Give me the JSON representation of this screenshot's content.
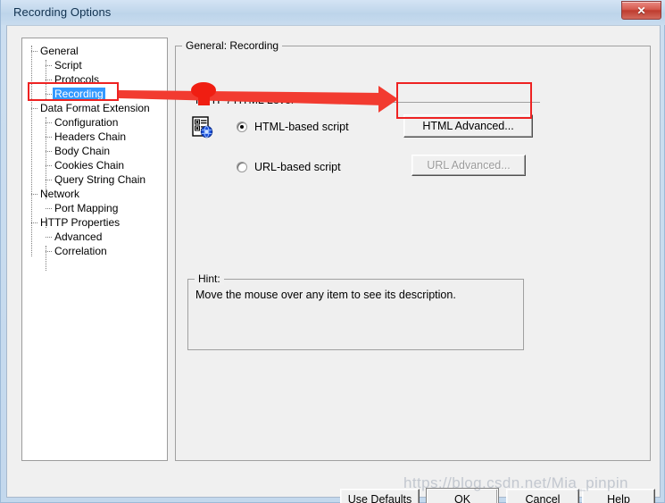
{
  "window": {
    "title": "Recording Options",
    "close_label": "✕",
    "close_icon": "close-icon"
  },
  "tree": {
    "items": [
      {
        "label": "General",
        "depth": 0,
        "selected": false
      },
      {
        "label": "Script",
        "depth": 1,
        "selected": false
      },
      {
        "label": "Protocols",
        "depth": 1,
        "selected": false
      },
      {
        "label": "Recording",
        "depth": 1,
        "selected": true
      },
      {
        "label": "Data Format Extension",
        "depth": 0,
        "selected": false
      },
      {
        "label": "Configuration",
        "depth": 1,
        "selected": false
      },
      {
        "label": "Headers Chain",
        "depth": 1,
        "selected": false
      },
      {
        "label": "Body Chain",
        "depth": 1,
        "selected": false
      },
      {
        "label": "Cookies Chain",
        "depth": 1,
        "selected": false
      },
      {
        "label": "Query String Chain",
        "depth": 1,
        "selected": false
      },
      {
        "label": "Network",
        "depth": 0,
        "selected": false
      },
      {
        "label": "Port Mapping",
        "depth": 1,
        "selected": false
      },
      {
        "label": "HTTP Properties",
        "depth": 0,
        "selected": false
      },
      {
        "label": "Advanced",
        "depth": 1,
        "selected": false
      },
      {
        "label": "Correlation",
        "depth": 1,
        "selected": false
      }
    ]
  },
  "main": {
    "group_title": "General: Recording",
    "section_title": "HTTP / HTML Level",
    "icon_name": "html-script-icon",
    "options": [
      {
        "label": "HTML-based script",
        "checked": true,
        "button": "HTML Advanced...",
        "button_enabled": true
      },
      {
        "label": "URL-based script",
        "checked": false,
        "button": "URL Advanced...",
        "button_enabled": false
      }
    ],
    "hint": {
      "title": "Hint:",
      "text": "Move the mouse over any item to see its description."
    }
  },
  "footer": {
    "buttons": [
      {
        "label": "Use Defaults",
        "default": false
      },
      {
        "label": "OK",
        "default": true
      },
      {
        "label": "Cancel",
        "default": false
      },
      {
        "label": "Help",
        "default": false
      }
    ]
  },
  "annotations": {
    "watermark": "https://blog.csdn.net/Mia_pinpin",
    "highlight_color": "#ee2222",
    "arrow_color": "#f23b30"
  },
  "colors": {
    "selection": "#3399ff",
    "dialog_face": "#f0f0f0",
    "title_bar": "#c6daee"
  }
}
